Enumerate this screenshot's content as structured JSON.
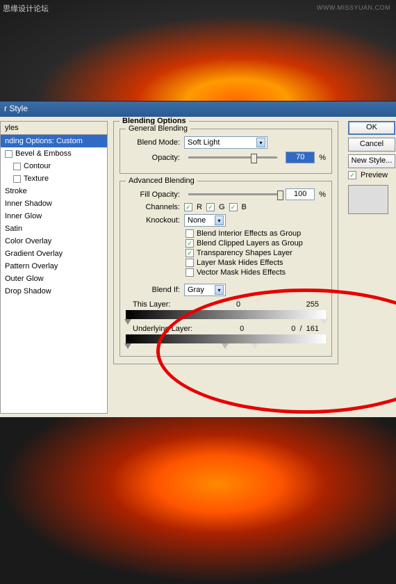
{
  "watermark": "思缘设计论坛",
  "watermark_url": "WWW.MISSYUAN.COM",
  "dialog": {
    "title": "r Style"
  },
  "sidebar": {
    "header": "yles",
    "active": "nding Options: Custom",
    "items": [
      {
        "label": "Bevel & Emboss",
        "checked": false
      },
      {
        "label": "Contour",
        "checked": false
      },
      {
        "label": "Texture",
        "checked": false
      },
      {
        "label": "Stroke",
        "checked": false
      },
      {
        "label": "Inner Shadow",
        "checked": false
      },
      {
        "label": "Inner Glow",
        "checked": false
      },
      {
        "label": "Satin",
        "checked": false
      },
      {
        "label": "Color Overlay",
        "checked": false
      },
      {
        "label": "Gradient Overlay",
        "checked": false
      },
      {
        "label": "Pattern Overlay",
        "checked": false
      },
      {
        "label": "Outer Glow",
        "checked": false
      },
      {
        "label": "Drop Shadow",
        "checked": false
      }
    ]
  },
  "blending": {
    "section": "Blending Options",
    "general": {
      "legend": "General Blending",
      "mode_label": "Blend Mode:",
      "mode_value": "Soft Light",
      "opacity_label": "Opacity:",
      "opacity_value": "70",
      "opacity_unit": "%"
    },
    "advanced": {
      "legend": "Advanced Blending",
      "fill_label": "Fill Opacity:",
      "fill_value": "100",
      "fill_unit": "%",
      "channels_label": "Channels:",
      "channels": [
        {
          "label": "R",
          "checked": true
        },
        {
          "label": "G",
          "checked": true
        },
        {
          "label": "B",
          "checked": true
        }
      ],
      "knockout_label": "Knockout:",
      "knockout_value": "None",
      "options": [
        {
          "label": "Blend Interior Effects as Group",
          "checked": false
        },
        {
          "label": "Blend Clipped Layers as Group",
          "checked": true
        },
        {
          "label": "Transparency Shapes Layer",
          "checked": true
        },
        {
          "label": "Layer Mask Hides Effects",
          "checked": false
        },
        {
          "label": "Vector Mask Hides Effects",
          "checked": false
        }
      ],
      "blendif_label": "Blend If:",
      "blendif_value": "Gray",
      "this_layer_label": "This Layer:",
      "this_layer_min": "0",
      "this_layer_max": "255",
      "underlying_label": "Underlying Layer:",
      "underlying_min": "0",
      "underlying_max_a": "0",
      "underlying_sep": "/",
      "underlying_max_b": "161"
    }
  },
  "buttons": {
    "ok": "OK",
    "cancel": "Cancel",
    "new_style": "New Style...",
    "preview": "Preview"
  }
}
